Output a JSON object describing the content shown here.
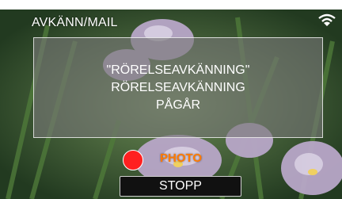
{
  "header": {
    "title": "AVKÄNN/MAIL"
  },
  "status": {
    "wifi_icon": "wifi-icon"
  },
  "message": {
    "lines": [
      "\"RÖRELSEAVKÄNNING\"",
      "RÖRELSEAVKÄNNING",
      "PÅGÅR"
    ]
  },
  "recording": {
    "indicator_icon": "record-dot-icon",
    "label": "PHOTO"
  },
  "controls": {
    "stop_label": "STOPP"
  },
  "colors": {
    "record_dot": "#ff2020",
    "photo_label": "#ff7a00",
    "overlay": "#787878"
  }
}
